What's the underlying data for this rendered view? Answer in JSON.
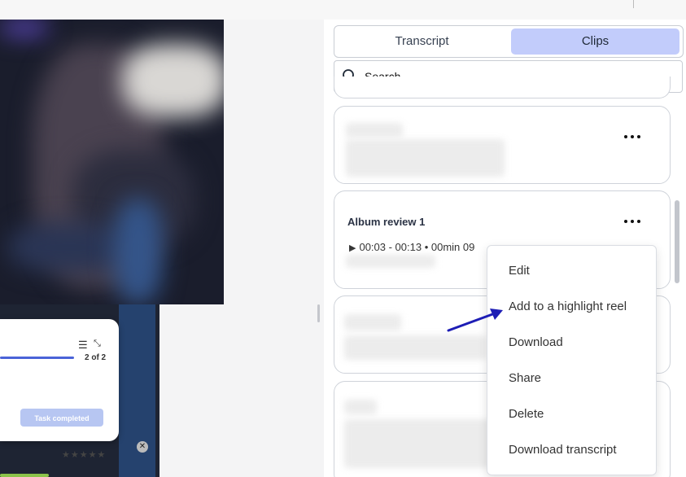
{
  "panel": {
    "tabs": [
      {
        "label": "Transcript",
        "active": false
      },
      {
        "label": "Clips",
        "active": true
      }
    ],
    "search": {
      "placeholder": "Search",
      "value": ""
    },
    "clip_card": {
      "title": "Album review 1",
      "play_glyph": "▶",
      "time_range": "00:03 - 00:13 • 00min 09"
    },
    "more_icon": "more-horizontal-icon"
  },
  "context_menu": {
    "items": [
      "Edit",
      "Add to a highlight reel",
      "Download",
      "Share",
      "Delete",
      "Download transcript"
    ],
    "highlighted_item": "Add to a highlight reel"
  },
  "task_widget": {
    "progress": "2 of 2",
    "button_label": "Task completed"
  },
  "rating": {
    "stars": "★★★★★"
  },
  "colors": {
    "active_tab": "#c2ccfb",
    "arrow": "#1d1db5",
    "progress_bar": "#4a63d8"
  }
}
